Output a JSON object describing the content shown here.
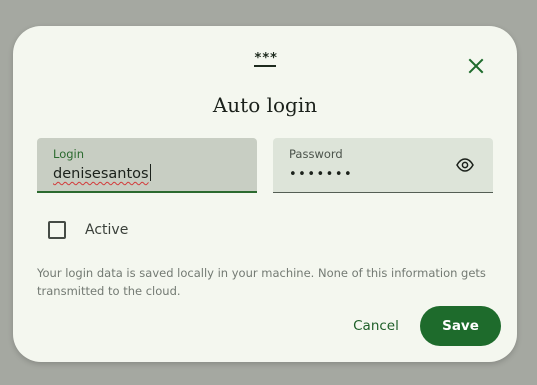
{
  "dialog": {
    "handle_label": "***",
    "title": "Auto login",
    "close_icon": "close-icon"
  },
  "login_field": {
    "label": "Login",
    "value": "denisesantos"
  },
  "password_field": {
    "label": "Password",
    "value": "•••••••",
    "toggle_icon": "eye-icon"
  },
  "active_checkbox": {
    "label": "Active",
    "checked": false
  },
  "info": {
    "text": "Your login data is saved locally in your machine. None of this information gets transmitted to the cloud."
  },
  "actions": {
    "cancel_label": "Cancel",
    "save_label": "Save"
  },
  "colors": {
    "primary": "#1e6b2c",
    "surface": "#f4f7ef",
    "backdrop": "#a5a8a1"
  }
}
